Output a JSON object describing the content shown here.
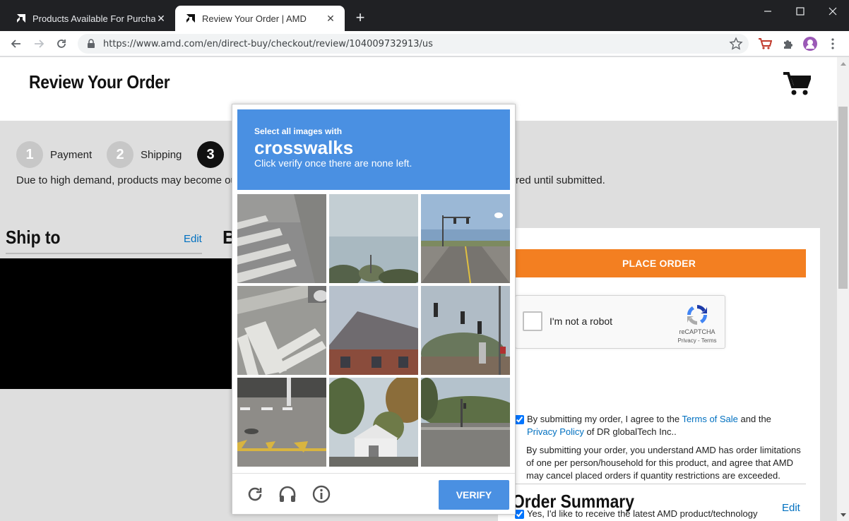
{
  "browser": {
    "tabs": [
      {
        "title": "Products Available For Purchase | AMD",
        "active": false
      },
      {
        "title": "Review Your Order | AMD",
        "active": true
      }
    ],
    "new_tab": "+",
    "url": "https://www.amd.com/en/direct-buy/checkout/review/104009732913/us"
  },
  "page": {
    "title": "Review Your Order",
    "steps": [
      {
        "number": "1",
        "label": "Payment",
        "state": "done"
      },
      {
        "number": "2",
        "label": "Shipping",
        "state": "done"
      },
      {
        "number": "3",
        "label": "",
        "state": "current"
      }
    ],
    "demand_note_start": "Due to high demand, products may become ou",
    "demand_note_end": "red until submitted.",
    "ship_to": {
      "title": "Ship to",
      "edit": "Edit"
    },
    "bill_title_fragment": "B",
    "place_order": "PLACE ORDER",
    "recaptcha": {
      "label": "I'm not a robot",
      "brand": "reCAPTCHA",
      "privacy": "Privacy",
      "separator": " - ",
      "terms": "Terms"
    },
    "agree": {
      "prefix": "By submitting my order, I agree to the ",
      "terms_link": "Terms of Sale",
      "middle": " and the ",
      "privacy_link": "Privacy Policy",
      "suffix": " of DR globalTech Inc..",
      "checked": true
    },
    "limitations_text": "By submitting your order, you understand AMD has order limitations of one per person/household for this product, and agree that AMD may cancel placed orders if quantity restrictions are exceeded.",
    "marketing": {
      "text": "Yes, I'd like to receive the latest AMD product/technology announcements and promotions.",
      "checked": true
    },
    "order_summary": {
      "title": "Order Summary",
      "edit": "Edit"
    }
  },
  "challenge": {
    "line1": "Select all images with",
    "target": "crosswalks",
    "line3": "Click verify once there are none left.",
    "tiles": [
      "crosswalk-road-closeup",
      "sky-and-treetops",
      "road-with-traffic-lights",
      "crosswalk-intersection",
      "brick-house-roof",
      "traffic-signals-street",
      "parking-lot-crosswalk",
      "house-with-trees",
      "street-intersection-trees"
    ],
    "verify": "VERIFY",
    "header_color": "#4a90e2"
  },
  "colors": {
    "accent_orange": "#f37f21",
    "link_blue": "#0070c0",
    "captcha_blue": "#4a90e2"
  }
}
